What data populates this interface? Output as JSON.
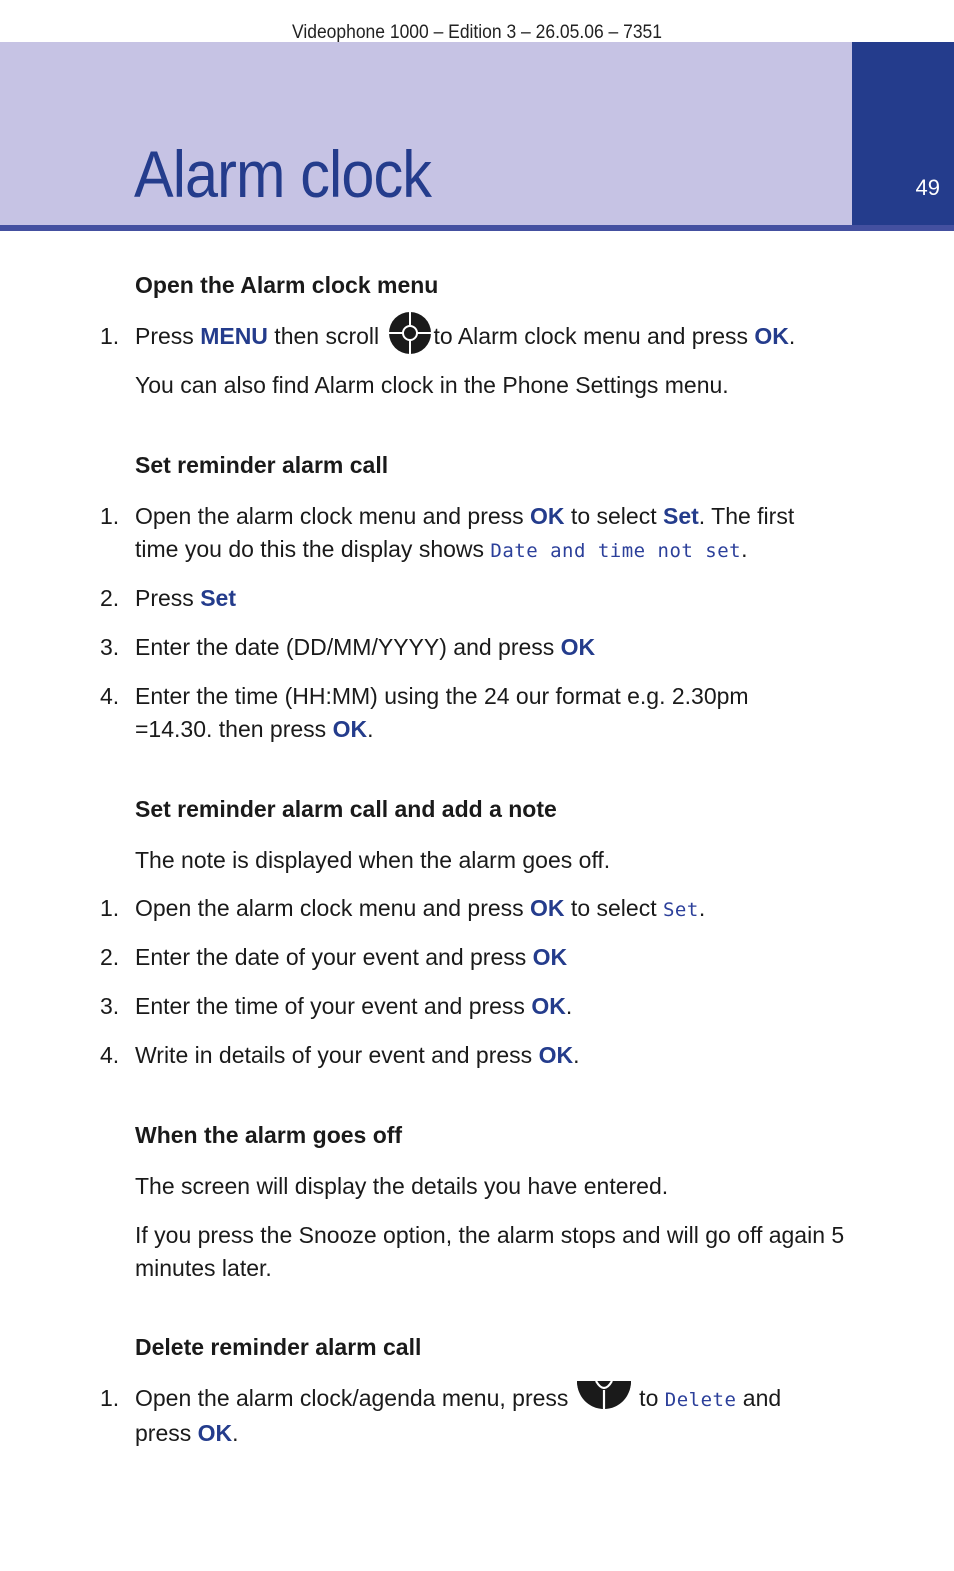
{
  "document": {
    "running_head": "Videophone 1000 – Edition 3 – 26.05.06 – 7351",
    "title": "Alarm clock",
    "page_number": "49",
    "colors": {
      "band": "#c6c3e4",
      "tab": "#243c8c",
      "rule": "#4450a0",
      "accent_text": "#243c8c"
    }
  },
  "sections": [
    {
      "heading": "Open the Alarm clock menu",
      "steps": [
        {
          "num": "1.",
          "parts": [
            "Press ",
            "MENU",
            " then scroll ",
            "to Alarm clock menu and press ",
            "OK",
            "."
          ],
          "icon": "navigation-pad-icon"
        }
      ],
      "note": "You can also find Alarm clock in the Phone Settings menu."
    },
    {
      "heading": "Set reminder alarm call",
      "steps": [
        {
          "num": "1.",
          "parts": [
            "Open the alarm clock menu and press ",
            "OK",
            " to select ",
            "Set",
            ". The first",
            "time you do this the display shows ",
            "Date and time not set",
            "."
          ]
        },
        {
          "num": "2.",
          "parts": [
            "Press ",
            "Set"
          ]
        },
        {
          "num": "3.",
          "parts": [
            "Enter the date (DD/MM/YYYY) and press ",
            "OK"
          ]
        },
        {
          "num": "4.",
          "parts": [
            "Enter the time (HH:MM) using the 24 our format e.g. 2.30pm",
            "=14.30. then press ",
            "OK",
            "."
          ]
        }
      ]
    },
    {
      "heading": "Set reminder alarm call and add a note",
      "intro": "The note is displayed when the alarm goes off.",
      "steps": [
        {
          "num": "1.",
          "parts": [
            "Open the alarm clock menu and press ",
            "OK",
            " to select ",
            "Set",
            "."
          ]
        },
        {
          "num": "2.",
          "parts": [
            "Enter the date of your event and press ",
            "OK"
          ]
        },
        {
          "num": "3.",
          "parts": [
            "Enter the time of your event and press ",
            "OK",
            "."
          ]
        },
        {
          "num": "4.",
          "parts": [
            "Write in details of your event and press ",
            "OK",
            "."
          ]
        }
      ]
    },
    {
      "heading": "When the alarm goes off",
      "paragraphs": [
        "The screen will display the details you have entered.",
        "If you press the Snooze option, the alarm stops and will go off again 5 minutes later."
      ]
    },
    {
      "heading": "Delete reminder alarm call",
      "steps": [
        {
          "num": "1.",
          "parts": [
            "Open the alarm clock/agenda menu, press ",
            " to ",
            "Delete",
            " and",
            "press ",
            "OK",
            "."
          ],
          "icon": "down-navigation-key-icon"
        }
      ]
    }
  ]
}
